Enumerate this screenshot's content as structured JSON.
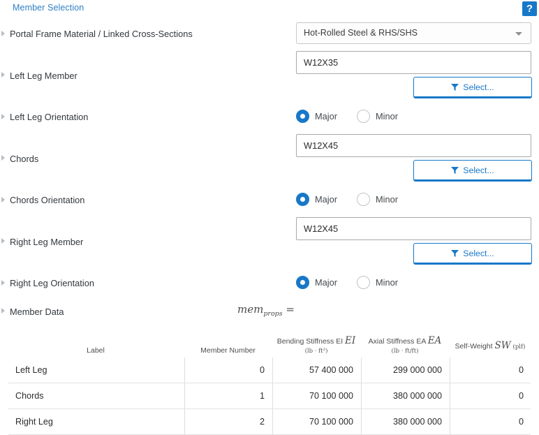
{
  "header": {
    "section_title": "Member Selection",
    "help_label": "?",
    "accent_color": "#1878c8"
  },
  "rows": [
    {
      "label": "Portal Frame Material / Linked Cross-Sections"
    },
    {
      "label": "Left Leg Member"
    },
    {
      "label": "Left Leg Orientation"
    },
    {
      "label": "Chords"
    },
    {
      "label": "Chords Orientation"
    },
    {
      "label": "Right Leg Member"
    },
    {
      "label": "Right Leg Orientation"
    },
    {
      "label": "Member Data"
    }
  ],
  "material_dropdown": {
    "value": "Hot-Rolled Steel & RHS/SHS"
  },
  "left_leg": {
    "section_value": "W12X35",
    "select_label": "Select...",
    "orientation_options": [
      "Major",
      "Minor"
    ],
    "orientation_selected": "Major"
  },
  "chords": {
    "section_value": "W12X45",
    "select_label": "Select...",
    "orientation_options": [
      "Major",
      "Minor"
    ],
    "orientation_selected": "Major"
  },
  "right_leg": {
    "section_value": "W12X45",
    "select_label": "Select...",
    "orientation_options": [
      "Major",
      "Minor"
    ],
    "orientation_selected": "Major"
  },
  "member_data": {
    "expression_base": "mem",
    "expression_sub": "props",
    "expression_equals": " ="
  },
  "chart_data": {
    "type": "table",
    "title": "mem_props",
    "columns": [
      {
        "label": "Label",
        "symbol": "",
        "units": ""
      },
      {
        "label": "Member Number",
        "symbol": "",
        "units": ""
      },
      {
        "label": "Bending Stiffness EI",
        "symbol": "EI",
        "units": "(lb · ft²)"
      },
      {
        "label": "Axial Stiffness EA",
        "symbol": "EA",
        "units": "(lb · ft/ft)"
      },
      {
        "label": "Self-Weight",
        "symbol": "SW",
        "units": "(plf)"
      }
    ],
    "rows": [
      {
        "label": "Left Leg",
        "member_number": "0",
        "bending_stiffness": "57 400 000",
        "axial_stiffness": "299 000 000",
        "self_weight": "0"
      },
      {
        "label": "Chords",
        "member_number": "1",
        "bending_stiffness": "70 100 000",
        "axial_stiffness": "380 000 000",
        "self_weight": "0"
      },
      {
        "label": "Right Leg",
        "member_number": "2",
        "bending_stiffness": "70 100 000",
        "axial_stiffness": "380 000 000",
        "self_weight": "0"
      }
    ]
  },
  "icons": {
    "expander": "triangle-right-icon",
    "dropdown": "chevron-down-icon",
    "select": "filter-funnel-icon",
    "help": "question-mark-icon"
  }
}
